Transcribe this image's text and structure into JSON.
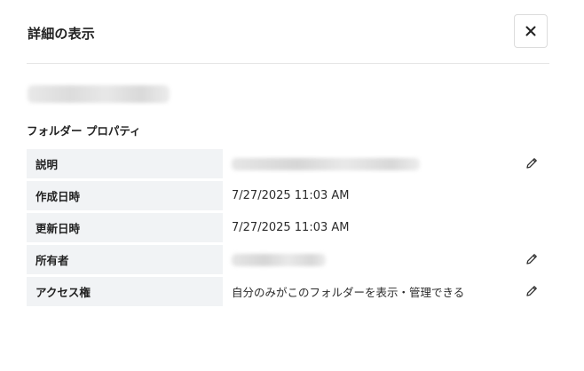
{
  "dialog": {
    "title": "詳細の表示",
    "close_label": "×"
  },
  "section": {
    "label": "フォルダー プロパティ"
  },
  "properties": [
    {
      "key": "説明",
      "value": "",
      "editable": true
    },
    {
      "key": "作成日時",
      "value": "7/27/2025 11:03 AM",
      "editable": false
    },
    {
      "key": "更新日時",
      "value": "7/27/2025 11:03 AM",
      "editable": false
    },
    {
      "key": "所有者",
      "value": "",
      "editable": true
    },
    {
      "key": "アクセス権",
      "value": "自分のみがこのフォルダーを表示・管理できる",
      "editable": true
    }
  ],
  "icons": {
    "close": "close-icon",
    "edit": "pencil-icon"
  }
}
